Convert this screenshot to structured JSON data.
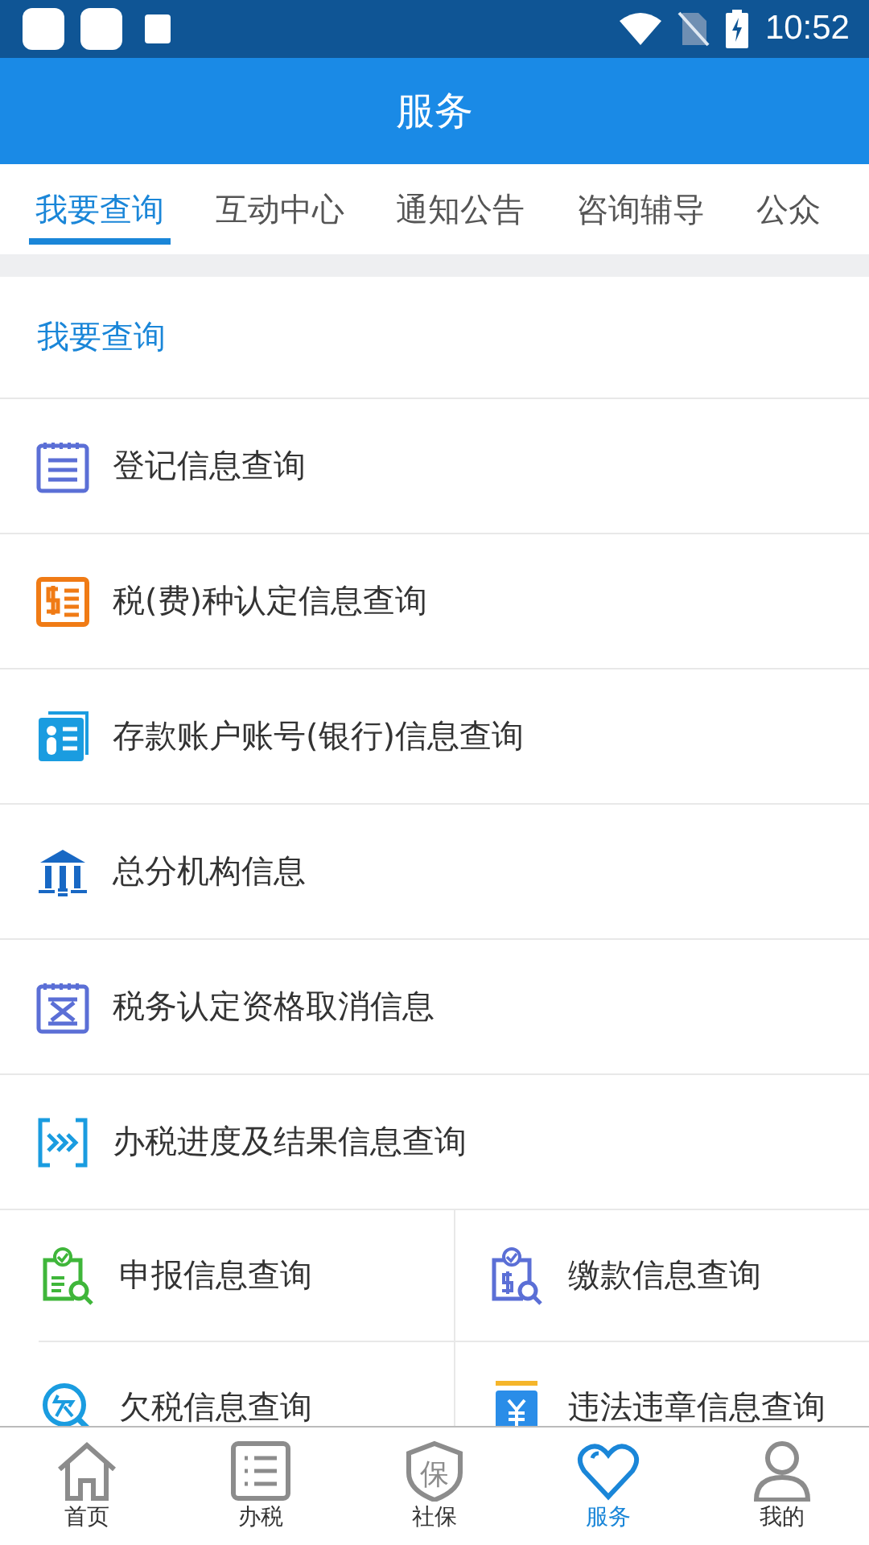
{
  "status_bar": {
    "time": "10:52"
  },
  "app_bar": {
    "title": "服务"
  },
  "tabs": [
    {
      "label": "我要查询",
      "selected": true
    },
    {
      "label": "互动中心",
      "selected": false
    },
    {
      "label": "通知公告",
      "selected": false
    },
    {
      "label": "咨询辅导",
      "selected": false
    },
    {
      "label": "公众",
      "selected": false
    }
  ],
  "section": {
    "title": "我要查询"
  },
  "list_items": [
    {
      "label": "登记信息查询"
    },
    {
      "label": "税(费)种认定信息查询"
    },
    {
      "label": "存款账户账号(银行)信息查询"
    },
    {
      "label": "总分机构信息"
    },
    {
      "label": "税务认定资格取消信息"
    },
    {
      "label": "办税进度及结果信息查询"
    }
  ],
  "grid_items": [
    {
      "label": "申报信息查询"
    },
    {
      "label": "缴款信息查询"
    },
    {
      "label": "欠税信息查询"
    },
    {
      "label": "违法违章信息查询"
    }
  ],
  "bottom_nav": [
    {
      "label": "首页",
      "selected": false
    },
    {
      "label": "办税",
      "selected": false
    },
    {
      "label": "社保",
      "selected": false,
      "icon_text": "保"
    },
    {
      "label": "服务",
      "selected": true
    },
    {
      "label": "我的",
      "selected": false
    }
  ]
}
